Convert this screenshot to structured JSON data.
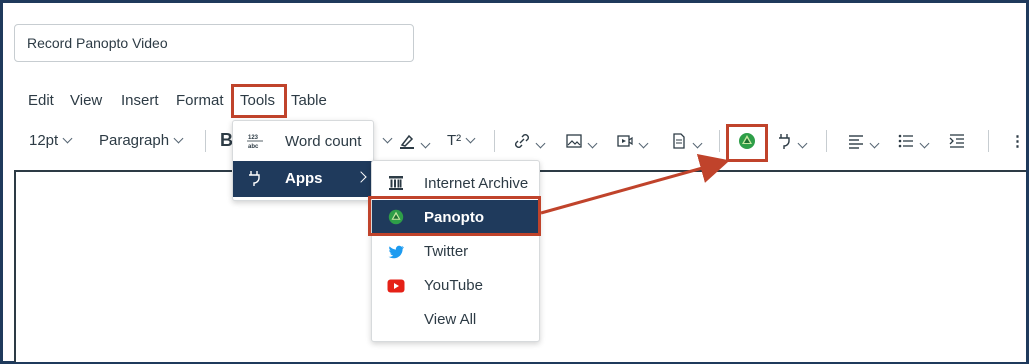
{
  "title_field": {
    "value": "Record Panopto Video"
  },
  "menubar": {
    "items": [
      "Edit",
      "View",
      "Insert",
      "Format",
      "Tools",
      "Table"
    ],
    "highlighted": "Tools"
  },
  "toolbar": {
    "font_size": "12pt",
    "block_format": "Paragraph",
    "superscript": "T²"
  },
  "tools_menu": {
    "items": [
      {
        "label": "Word count",
        "icon": "word-count-icon"
      },
      {
        "label": "Apps",
        "icon": "plug-icon",
        "active": true
      }
    ]
  },
  "apps_menu": {
    "items": [
      {
        "label": "Internet Archive",
        "icon": "internet-archive-icon"
      },
      {
        "label": "Panopto",
        "icon": "panopto-icon",
        "active": true
      },
      {
        "label": "Twitter",
        "icon": "twitter-icon"
      },
      {
        "label": "YouTube",
        "icon": "youtube-icon"
      },
      {
        "label": "View All",
        "icon": ""
      }
    ]
  },
  "colors": {
    "highlight": "#c0432b",
    "active_bg": "#1f3a5c",
    "panopto_green": "#2e9e48",
    "youtube_red": "#e52117",
    "twitter_blue": "#1d9bf0"
  }
}
